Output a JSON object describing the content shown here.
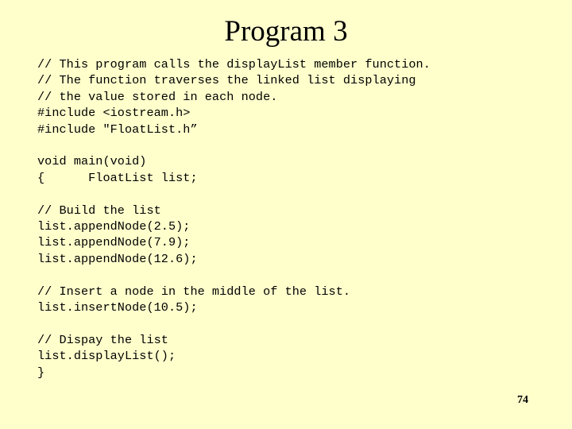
{
  "slide": {
    "title": "Program 3",
    "page_number": "74",
    "background_color": "#ffffcc",
    "text_color": "#000000"
  },
  "code": {
    "language": "C++",
    "lines": [
      "// This program calls the displayList member function.",
      "// The function traverses the linked list displaying",
      "// the value stored in each node.",
      "#include <iostream.h>",
      "#include \"FloatList.h”",
      "",
      "void main(void)",
      "{      FloatList list;",
      "",
      "// Build the list",
      "list.appendNode(2.5);",
      "list.appendNode(7.9);",
      "list.appendNode(12.6);",
      "",
      "// Insert a node in the middle of the list.",
      "list.insertNode(10.5);",
      "",
      "// Dispay the list",
      "list.displayList();",
      "}"
    ]
  }
}
